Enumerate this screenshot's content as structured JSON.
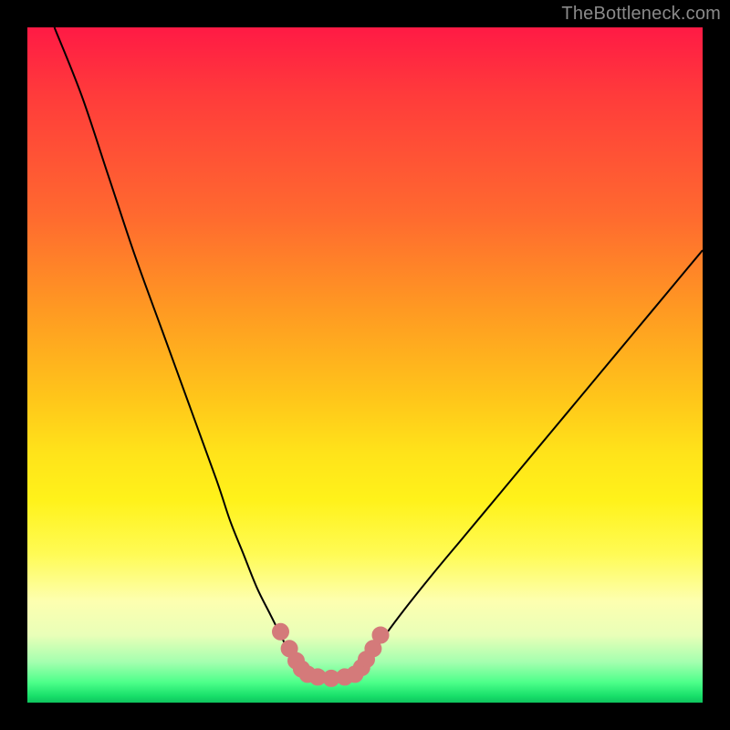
{
  "watermark": {
    "text": "TheBottleneck.com"
  },
  "colors": {
    "curve_stroke": "#000000",
    "marker_fill": "#d47a7a",
    "marker_stroke": "#d47a7a",
    "bg_black": "#000000"
  },
  "chart_data": {
    "type": "line",
    "title": "",
    "xlabel": "",
    "ylabel": "",
    "xlim": [
      0,
      100
    ],
    "ylim": [
      0,
      100
    ],
    "grid": false,
    "series": [
      {
        "name": "left-curve",
        "x": [
          4,
          8,
          12,
          16,
          20,
          24,
          28,
          30,
          32,
          34,
          36,
          38,
          39,
          40,
          41
        ],
        "y": [
          100,
          90,
          78,
          66,
          55,
          44,
          33,
          27,
          22,
          17,
          13,
          9,
          7,
          5.5,
          4.5
        ]
      },
      {
        "name": "right-curve",
        "x": [
          49,
          50,
          51,
          53,
          56,
          60,
          65,
          70,
          75,
          80,
          85,
          90,
          95,
          100
        ],
        "y": [
          4.5,
          5.5,
          7,
          10,
          14,
          19,
          25,
          31,
          37,
          43,
          49,
          55,
          61,
          67
        ]
      },
      {
        "name": "flat-min",
        "x": [
          41,
          43,
          45,
          47,
          49
        ],
        "y": [
          4.0,
          3.7,
          3.6,
          3.7,
          4.0
        ]
      }
    ],
    "markers": {
      "name": "highlight-points",
      "points": [
        {
          "x": 37.5,
          "y": 10.5
        },
        {
          "x": 38.8,
          "y": 8.0
        },
        {
          "x": 39.8,
          "y": 6.2
        },
        {
          "x": 40.6,
          "y": 5.0
        },
        {
          "x": 41.5,
          "y": 4.2
        },
        {
          "x": 43.0,
          "y": 3.8
        },
        {
          "x": 45.0,
          "y": 3.6
        },
        {
          "x": 47.0,
          "y": 3.8
        },
        {
          "x": 48.5,
          "y": 4.2
        },
        {
          "x": 49.5,
          "y": 5.2
        },
        {
          "x": 50.2,
          "y": 6.4
        },
        {
          "x": 51.2,
          "y": 8.0
        },
        {
          "x": 52.3,
          "y": 10.0
        }
      ]
    }
  }
}
